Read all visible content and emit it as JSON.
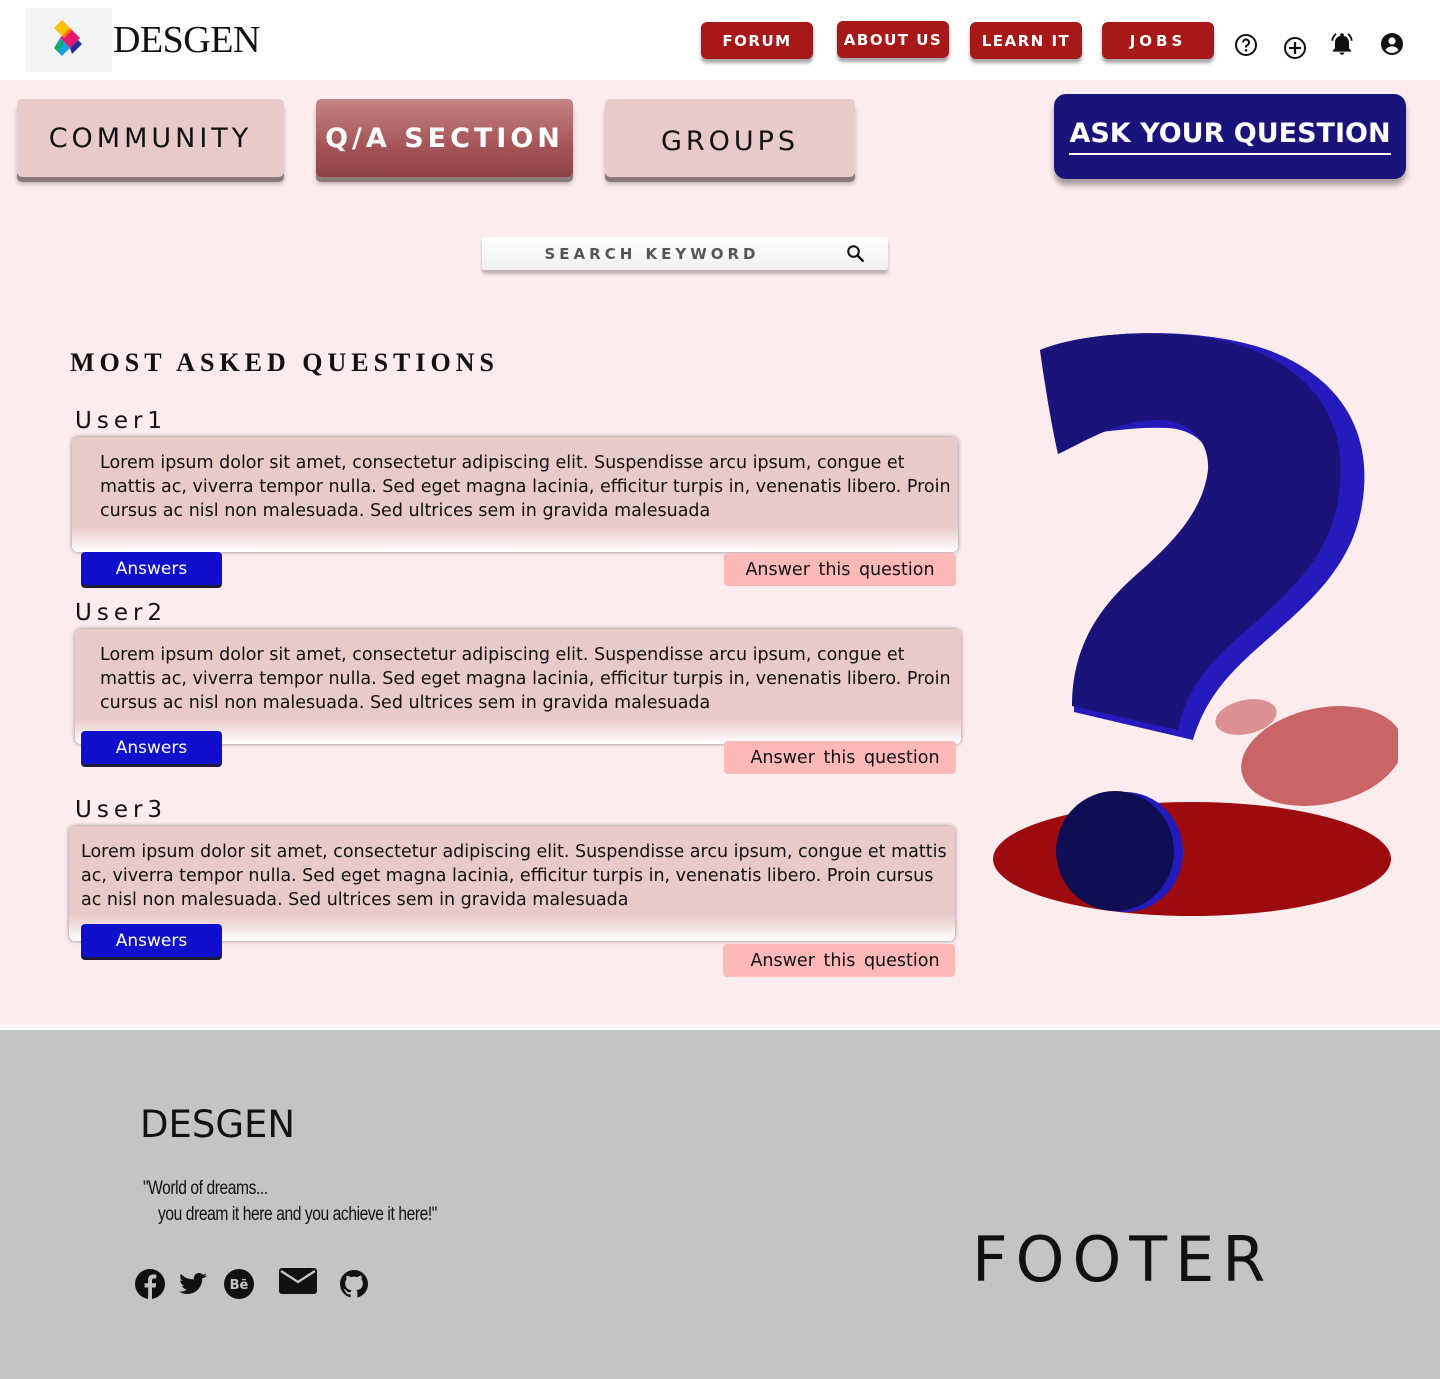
{
  "header": {
    "brand": "DESGEN",
    "nav": [
      "FORUM",
      "ABOUT US",
      "LEARN IT",
      "JOBS"
    ],
    "icons": [
      "help-icon",
      "add-circle-icon",
      "notification-bell-icon",
      "account-icon"
    ]
  },
  "tabs": [
    "COMMUNITY",
    "Q/A SECTION",
    "GROUPS"
  ],
  "ask_button": "ASK YOUR QUESTION",
  "search": {
    "placeholder": "SEARCH KEYWORD"
  },
  "section_title": "MOST ASKED QUESTIONS",
  "questions": [
    {
      "user": "User1",
      "text": "Lorem ipsum dolor sit amet, consectetur adipiscing elit. Suspendisse arcu ipsum, congue et mattis ac, viverra tempor nulla. Sed eget magna lacinia, efficitur turpis in, venenatis libero. Proin cursus ac nisl non malesuada. Sed ultrices sem in gravida malesuada",
      "answers_label": "Answers",
      "answer_label": "Answer this  question"
    },
    {
      "user": "User2",
      "text": "Lorem ipsum dolor sit amet, consectetur adipiscing elit. Suspendisse arcu ipsum, congue et mattis ac, viverra tempor nulla. Sed eget magna lacinia, efficitur turpis in, venenatis libero. Proin cursus ac nisl non malesuada. Sed ultrices sem in gravida malesuada",
      "answers_label": "Answers",
      "answer_label": "Answer this  question"
    },
    {
      "user": "User3",
      "text": "Lorem ipsum dolor sit amet, consectetur adipiscing elit. Suspendisse arcu ipsum, congue et mattis ac, viverra tempor nulla. Sed eget magna lacinia, efficitur turpis in, venenatis libero. Proin cursus ac nisl non malesuada. Sed ultrices sem in gravida malesuada",
      "answers_label": "Answers",
      "answer_label": "Answer this  question"
    }
  ],
  "footer": {
    "brand": "DESGEN",
    "tagline_line1": "\"World of dreams...",
    "tagline_line2": "you dream it here and you achieve it here!\"",
    "social_icons": [
      "facebook-icon",
      "twitter-icon",
      "behance-icon",
      "mail-icon",
      "github-icon"
    ],
    "label": "FOOTER"
  },
  "colors": {
    "nav_red": "#a71818",
    "main_bg": "#fdeced",
    "ask_navy": "#1a137a",
    "answers_blue": "#1010cc",
    "answer_pink": "#fdb8b8",
    "footer_gray": "#c4c4c4"
  }
}
